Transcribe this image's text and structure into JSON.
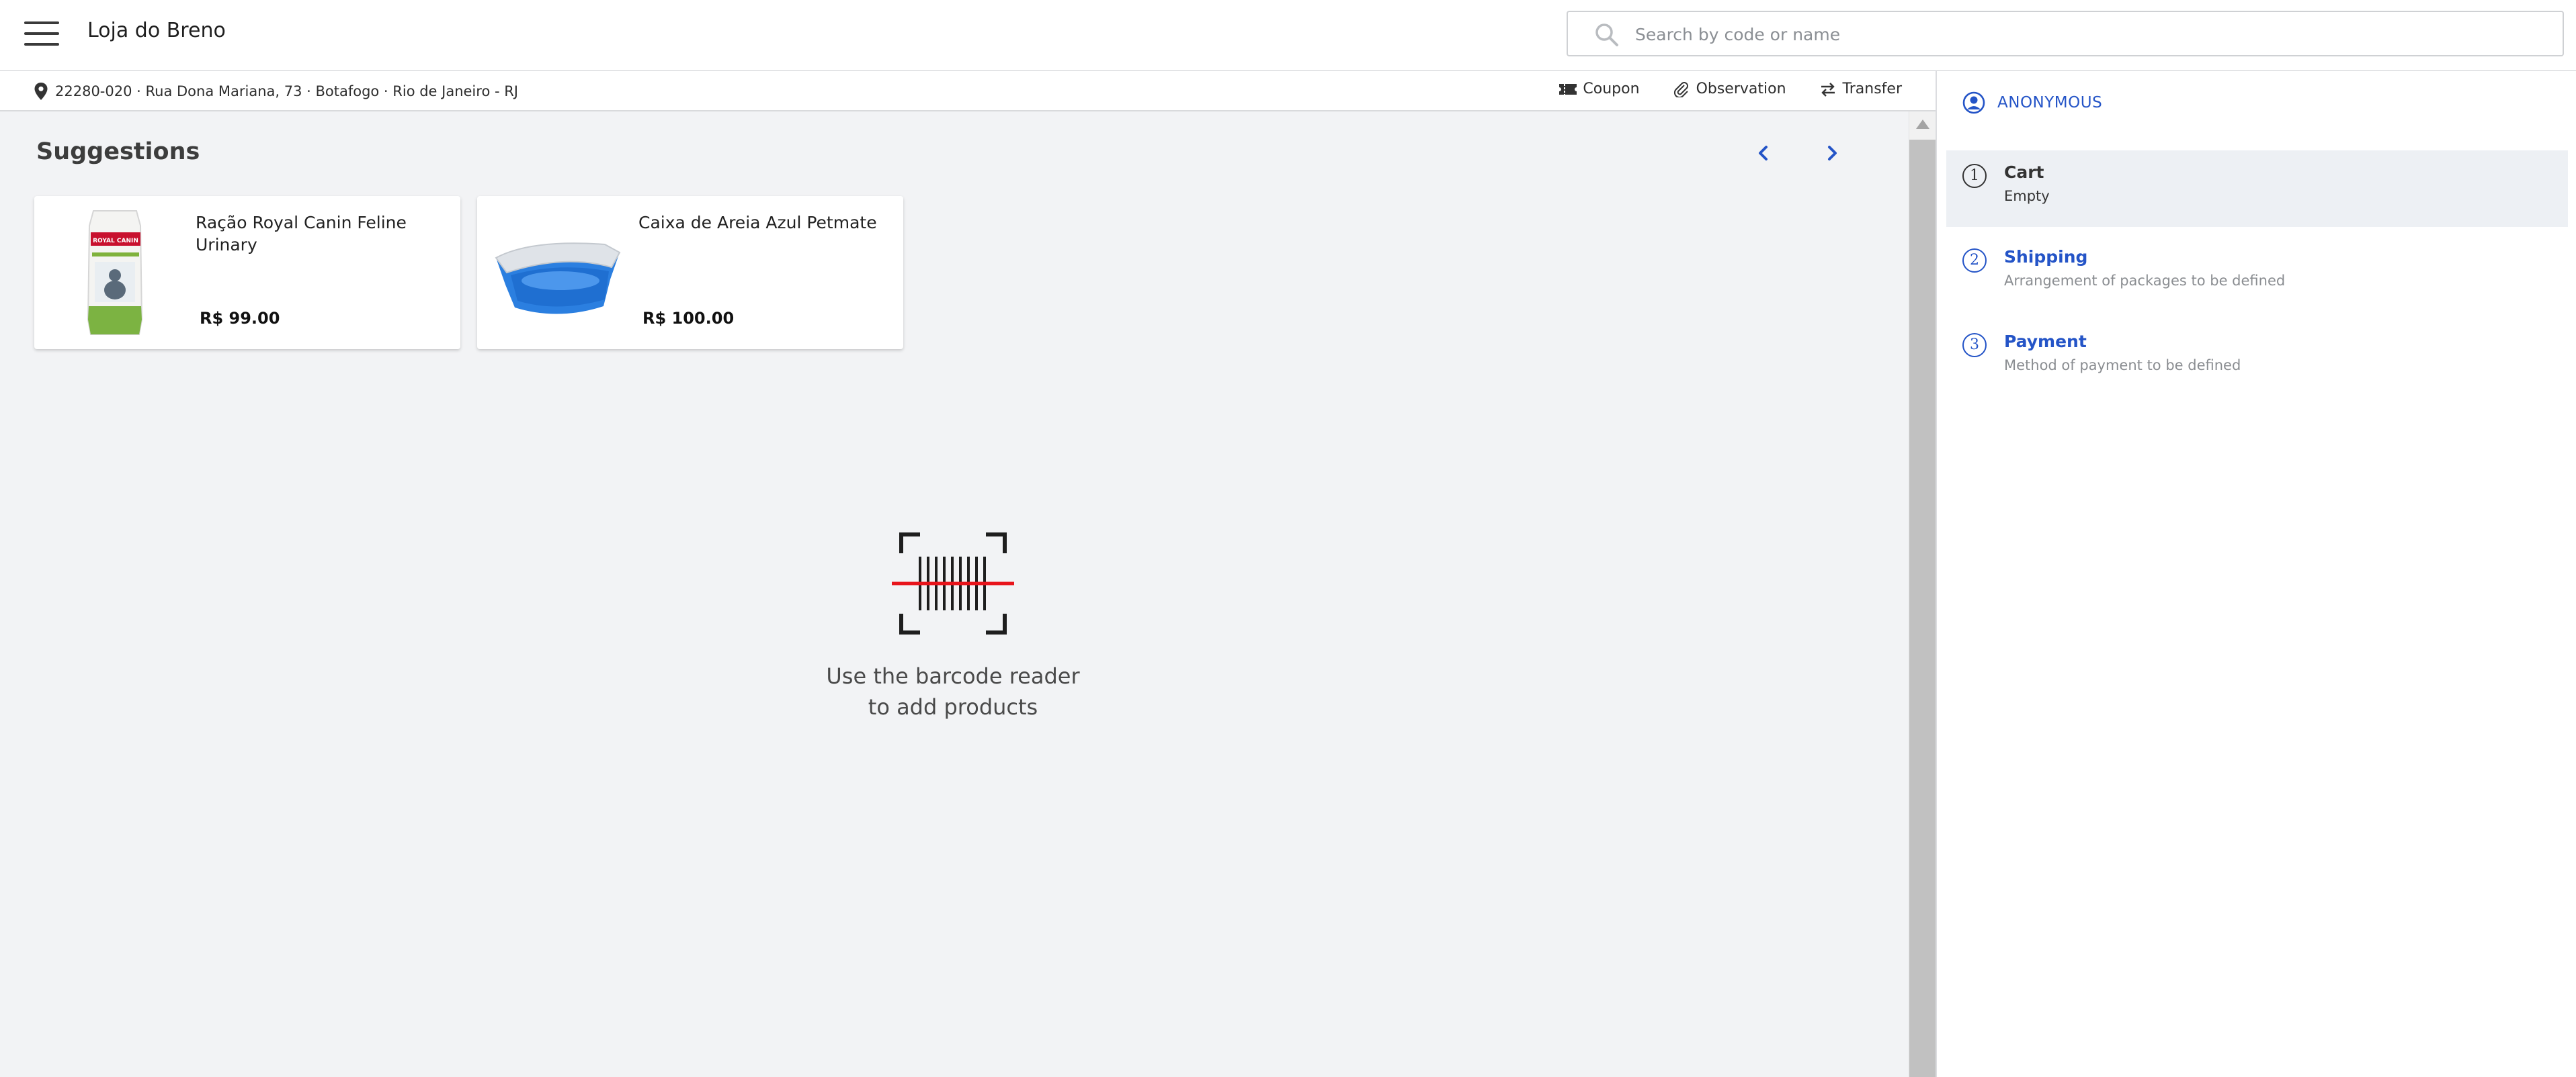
{
  "header": {
    "store_name": "Loja do Breno",
    "search_placeholder": "Search by code or name"
  },
  "address": {
    "text": "22280-020  ·  Rua Dona Mariana, 73 · Botafogo · Rio de Janeiro - RJ"
  },
  "actions": [
    {
      "label": "Coupon",
      "icon": "coupon-icon"
    },
    {
      "label": "Observation",
      "icon": "paperclip-icon"
    },
    {
      "label": "Transfer",
      "icon": "transfer-icon"
    }
  ],
  "suggestions": {
    "title": "Suggestions",
    "items": [
      {
        "name": "Ração Royal Canin Feline Urinary",
        "price": "R$ 99.00",
        "image": "cat-food-bag-image"
      },
      {
        "name": "Caixa de Areia Azul Petmate",
        "price": "R$ 100.00",
        "image": "litter-box-image"
      }
    ]
  },
  "empty_state": {
    "line1": "Use the barcode reader",
    "line2": "to add products",
    "icon": "barcode-scanner-icon"
  },
  "panel": {
    "customer": "ANONYMOUS",
    "steps": [
      {
        "number": "1",
        "title": "Cart",
        "subtitle": "Empty"
      },
      {
        "number": "2",
        "title": "Shipping",
        "subtitle": "Arrangement of packages to be defined"
      },
      {
        "number": "3",
        "title": "Payment",
        "subtitle": "Method of payment to be defined"
      }
    ]
  },
  "colors": {
    "accent": "#2454c7",
    "main_bg": "#f2f3f5",
    "scan_line": "#e8141b"
  }
}
